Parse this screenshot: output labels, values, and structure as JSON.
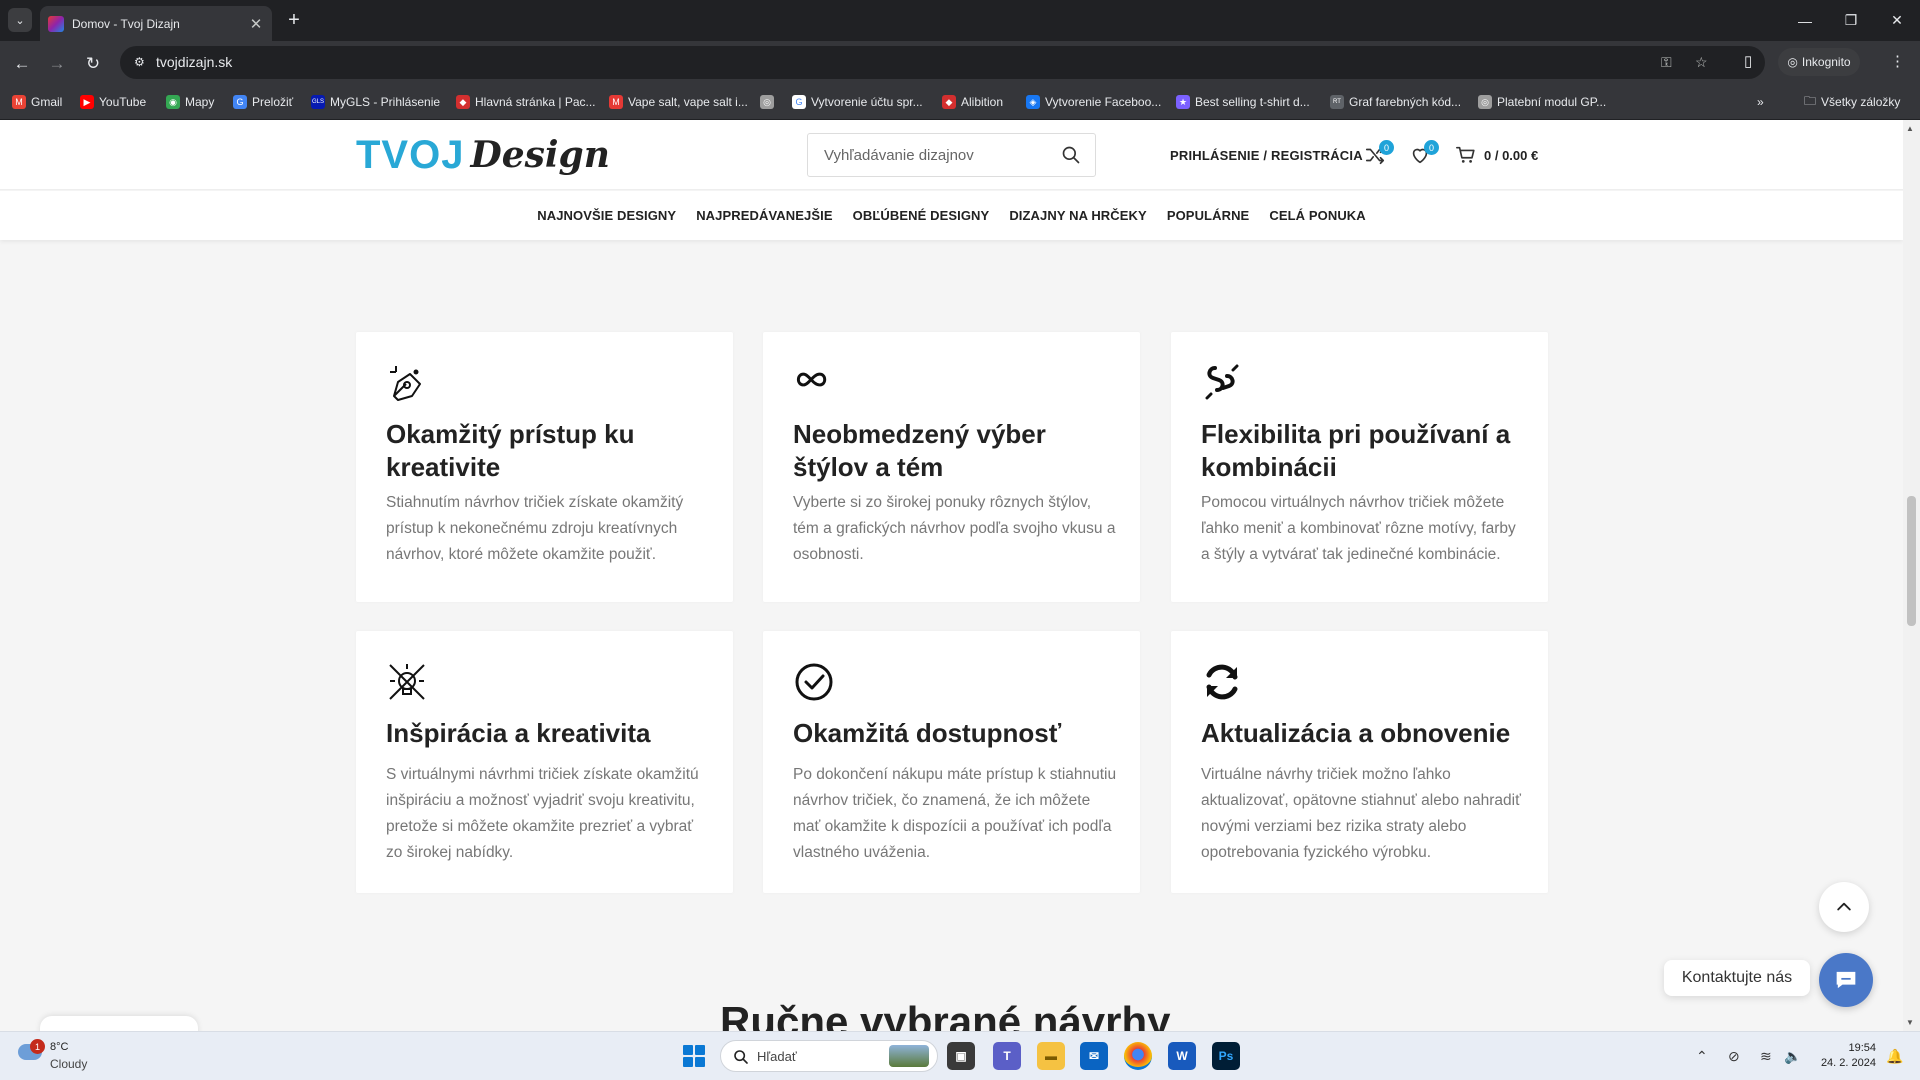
{
  "browser": {
    "tab_title": "Domov - Tvoj Dizajn",
    "url": "tvojdizajn.sk",
    "incognito_label": "Inkognito",
    "all_bookmarks": "Všetky záložky",
    "bookmarks": [
      {
        "label": "Gmail",
        "color": "#ea4335",
        "glyph": "M"
      },
      {
        "label": "YouTube",
        "color": "#ff0000",
        "glyph": "▶"
      },
      {
        "label": "Mapy",
        "color": "#34a853",
        "glyph": "◉"
      },
      {
        "label": "Preložiť",
        "color": "#4285f4",
        "glyph": "G"
      },
      {
        "label": "MyGLS - Prihlásenie",
        "color": "#061ab1",
        "glyph": "GLS"
      },
      {
        "label": "Hlavná stránka | Pac...",
        "color": "#d32f2f",
        "glyph": "◆"
      },
      {
        "label": "Vape salt, vape salt i...",
        "color": "#e53935",
        "glyph": "M"
      },
      {
        "label": "",
        "color": "#9e9e9e",
        "glyph": "◎"
      },
      {
        "label": "Vytvorenie účtu spr...",
        "color": "#ffffff",
        "glyph": "G"
      },
      {
        "label": "Alibition",
        "color": "#d32f2f",
        "glyph": "◆"
      },
      {
        "label": "Vytvorenie Faceboo...",
        "color": "#1877f2",
        "glyph": "◈"
      },
      {
        "label": "Best selling t-shirt d...",
        "color": "#7b61ff",
        "glyph": "★"
      },
      {
        "label": "Graf farebných kód...",
        "color": "#5f6368",
        "glyph": "RT"
      },
      {
        "label": "Platební modul GP...",
        "color": "#9e9e9e",
        "glyph": "◎"
      }
    ]
  },
  "header": {
    "logo_part1": "TVOJ",
    "logo_part2": "Design",
    "search_placeholder": "Vyhľadávanie dizajnov",
    "login_label": "PRIHLÁSENIE / REGISTRÁCIA",
    "compare_count": "0",
    "wishlist_count": "0",
    "cart_label": "0 / 0.00 €"
  },
  "nav": [
    "NAJNOVŠIE DESIGNY",
    "NAJPREDÁVANEJŠIE",
    "OBĽÚBENÉ DESIGNY",
    "DIZAJNY NA HRČEKY",
    "POPULÁRNE",
    "CELÁ PONUKA"
  ],
  "features": [
    {
      "icon": "pen-tool-icon",
      "title": "Okamžitý prístup ku kreativite",
      "text": "Stiahnutím návrhov tričiek získate okamžitý prístup k nekonečnému zdroju kreatívnych návrhov, ktoré môžete okamžite použiť."
    },
    {
      "icon": "infinity-icon",
      "title": "Neobmedzený výber štýlov a tém",
      "text": "Vyberte si zo širokej ponuky rôznych štýlov, tém a grafických návrhov podľa svojho vkusu a osobnosti."
    },
    {
      "icon": "link-icon",
      "title": "Flexibilita pri používaní a kombinácii",
      "text": "Pomocou virtuálnych návrhov tričiek môžete ľahko meniť a kombinovať rôzne motívy, farby a štýly a vytvárať tak jedinečné kombinácie."
    },
    {
      "icon": "bulb-tools-icon",
      "title": "Inšpirácia a kreativita",
      "text": "S virtuálnymi návrhmi tričiek získate okamžitú inšpiráciu a možnosť vyjadriť svoju kreativitu, pretože si môžete okamžite prezrieť a vybrať zo širokej nabídky."
    },
    {
      "icon": "check-circle-icon",
      "title": "Okamžitá dostupnosť",
      "text": "Po dokončení nákupu máte prístup k stiahnutiu návrhov tričiek, čo znamená, že ich môžete mať okamžite k dispozícii a používať ich podľa vlastného uváženia."
    },
    {
      "icon": "refresh-icon",
      "title": "Aktualizácia a obnovenie",
      "text": "Virtuálne návrhy tričiek možno ľahko aktualizovať, opätovne stiahnuť alebo nahradiť novými verziami bez rizika straty alebo opotrebovania fyzického výrobku."
    }
  ],
  "section_title": "Ručne vybrané návrhy",
  "contact_label": "Kontaktujte nás",
  "taskbar": {
    "temperature": "8°C",
    "condition": "Cloudy",
    "weather_badge": "1",
    "search_label": "Hľadať",
    "time": "19:54",
    "date": "24. 2. 2024"
  }
}
